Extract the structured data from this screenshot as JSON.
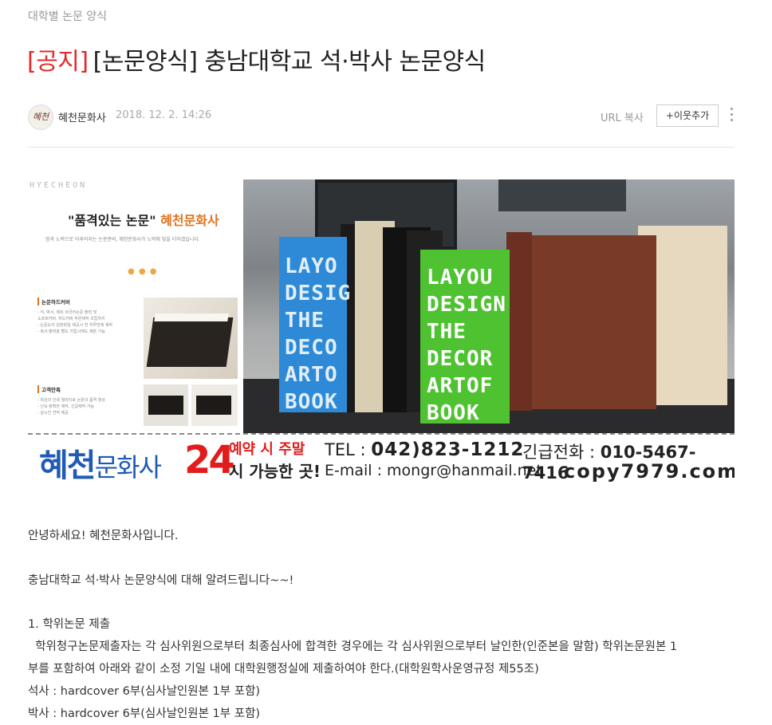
{
  "category": "대학별 논문 양식",
  "title": {
    "notice": "[공지]",
    "text": "[논문양식] 충남대학교 석·박사 논문양식"
  },
  "author": {
    "avatar_text": "혜천",
    "nickname": "혜천문화사",
    "date": "2018. 12. 2. 14:26"
  },
  "actions": {
    "url_copy": "URL 복사",
    "add_neighbor": "+이웃추가"
  },
  "banner": {
    "watermark": "HYECHEON",
    "slogan_quote": "\"품격있는 논문\"",
    "slogan_brand": "혜천문화사",
    "sub_slogan": "땀과 노력으로 이루어지는 논문준비, 혜천문화사가 노력해 빛을 더하겠습니다.",
    "feature1_title": "논문하드커버",
    "feature1_lines": "- 석, 박사, 제외 외국어논문 출력 및\n 소프트커버, 하드커버 주문제작 조립까지\n- 논문도지 원본파일 제공시 전 하루만에 제작\n- 복사·출력을 빨도 지업시에도 제본 가능",
    "feature2_title": "고객만족",
    "feature2_lines": "- 최상의 인쇄 퀄리티로 논문의 품격 향상\n- 신속·정확한 제작, 긴급제작 가능\n- 실시간 견적 제공",
    "cover_blue": "LAYO\nDESIG\nTHE\nDECO\nARTO\nBOOK",
    "cover_green": "LAYOU\nDESIGN\nTHE\nDECOR\nARTOF\nBOOK",
    "contact": {
      "name_main": "혜천",
      "name_suffix": "문화사",
      "hours": "24",
      "reservation_line1": "예약 시 주말",
      "reservation_line2": "시 가능한 곳!",
      "tel_label": "TEL : ",
      "tel": "042)823-1212",
      "email": "E-mail : mongr@hanmail.net",
      "urgent_label": "긴급전화 : ",
      "urgent": "010-5467-7416",
      "website": "copy7979.com"
    }
  },
  "body": {
    "greeting": "안녕하세요! 혜천문화사입니다.",
    "intro": "충남대학교 석·박사 논문양식에 대해 알려드립니다~~!",
    "section1_title": "1. 학위논문 제출",
    "section1_line1": "  학위청구논문제출자는 각 심사위원으로부터 최종심사에 합격한 경우에는 각 심사위원으로부터 날인한(인준본을 말함) 학위논문원본 1",
    "section1_line2": "부를 포함하여 아래와 같이 소정 기일 내에 대학원행정실에 제출하여야 한다.(대학원학사운영규정 제55조)",
    "masters": "석사 : hardcover 6부(심사날인원본 1부 포함)",
    "doctoral": "박사 : hardcover 6부(심사날인원본 1부 포함)"
  }
}
